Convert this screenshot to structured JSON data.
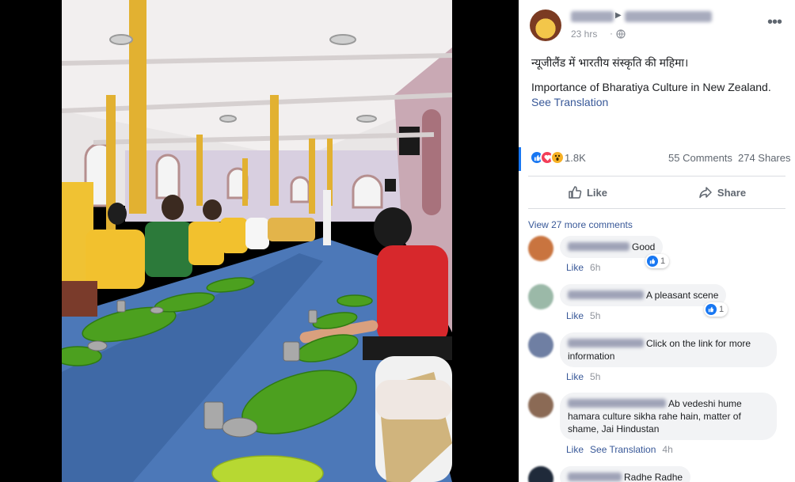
{
  "post": {
    "time": "23 hrs",
    "text_hindi": "न्यूजीलैंड में भारतीय संस्कृति की महिमा।",
    "text_english": "Importance of Bharatiya Culture in New Zealand.",
    "see_translation": "See Translation"
  },
  "stats": {
    "reactions_count": "1.8K",
    "comments": "55 Comments",
    "shares": "274 Shares"
  },
  "actions": {
    "like_label": "Like",
    "share_label": "Share"
  },
  "comments_section": {
    "view_more": "View 27 more comments",
    "items": [
      {
        "text": "Good",
        "like": "Like",
        "time": "6h",
        "reactions": "1"
      },
      {
        "text": "A pleasant scene",
        "like": "Like",
        "time": "5h",
        "reactions": "1"
      },
      {
        "text": "Click on the link for more information",
        "like": "Like",
        "time": "5h"
      },
      {
        "text": "Ab vedeshi hume hamara culture sikha rahe hain, matter of shame, Jai Hindustan",
        "like": "Like",
        "see_translation": "See Translation",
        "time": "4h"
      },
      {
        "text": "Radhe Radhe"
      }
    ]
  },
  "colors": {
    "link": "#385898",
    "like_blue": "#1877f2",
    "love_red": "#f33e58",
    "wow_yellow": "#f7b125"
  },
  "icons": [
    "globe-icon",
    "more-options-icon",
    "like-reaction-icon",
    "love-reaction-icon",
    "wow-reaction-icon",
    "thumbs-up-icon",
    "share-arrow-icon"
  ]
}
